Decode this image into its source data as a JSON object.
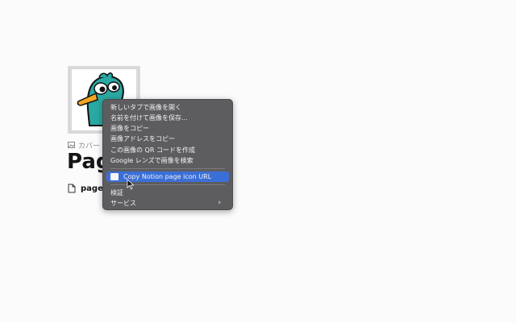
{
  "page": {
    "cover_label": "カバー",
    "title": "Pag",
    "sub_label": "page"
  },
  "context_menu": {
    "items": [
      "新しいタブで画像を開く",
      "名前を付けて画像を保存...",
      "画像をコピー",
      "画像アドレスをコピー",
      "この画像の QR コードを作成",
      "Google レンズで画像を検索"
    ],
    "highlighted_item": "Copy Notion page icon URL",
    "inspect_label": "検証",
    "services_label": "サービス",
    "submenu_arrow": "›"
  },
  "colors": {
    "menu_bg": "#5d5d60",
    "highlight": "#3b6fd8",
    "platypus_teal": "#2aa9a3",
    "beak_orange": "#f5a623"
  }
}
